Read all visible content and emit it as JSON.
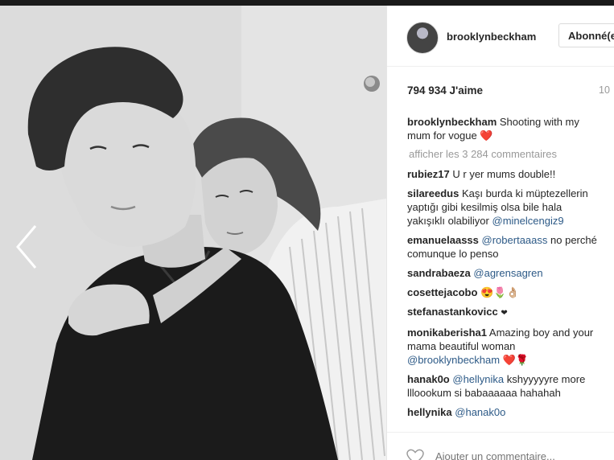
{
  "post": {
    "author": "brooklynbeckham",
    "follow_label": "Abonné(e)",
    "likes": "794 934 J'aime",
    "time_ago": "10",
    "caption_user": "brooklynbeckham",
    "caption_text": "Shooting with my",
    "caption_text_2": "mum for vogue",
    "caption_emoji": "❤️",
    "load_more": "afficher les 3 284 commentaires",
    "add_comment_placeholder": "Ajouter un commentaire..."
  },
  "comments": [
    {
      "user": "rubiez17",
      "text": "U r yer mums double!!"
    },
    {
      "user": "silareedus",
      "text": "Kaşı burda ki müptezellerin",
      "line2": "yaptığı gibi kesilmiş olsa bile hala",
      "line3": "yakışıklı olabiliyor",
      "mention": "@minelcengiz9"
    },
    {
      "user": "emanuelaasss",
      "mention": "@robertaaass",
      "text": "no perché",
      "line2": "comunque lo penso"
    },
    {
      "user": "sandrabaeza",
      "mention": "@agrensagren"
    },
    {
      "user": "cosettejacobo",
      "emoji": "😍🌷👌🏼"
    },
    {
      "user": "stefanastankovicc",
      "emoji": "❤"
    },
    {
      "user": "monikaberisha1",
      "text": "Amazing boy and your",
      "line2": "mama beautiful woman",
      "mention": "@brooklynbeckham",
      "emoji": "❤️🌹"
    },
    {
      "user": "hanak0o",
      "mention": "@hellynika",
      "text": "kshyyyyyre more",
      "line2": "llloookum si babaaaaaa hahahah"
    },
    {
      "user": "hellynika",
      "mention": "@hanak0o"
    }
  ],
  "icons": {
    "prev": "chevron-left-icon",
    "like": "heart-outline-icon",
    "avatar": "profile-avatar"
  },
  "colors": {
    "mention": "#2d5a87",
    "heart": "#e0242f",
    "muted": "#999999"
  }
}
